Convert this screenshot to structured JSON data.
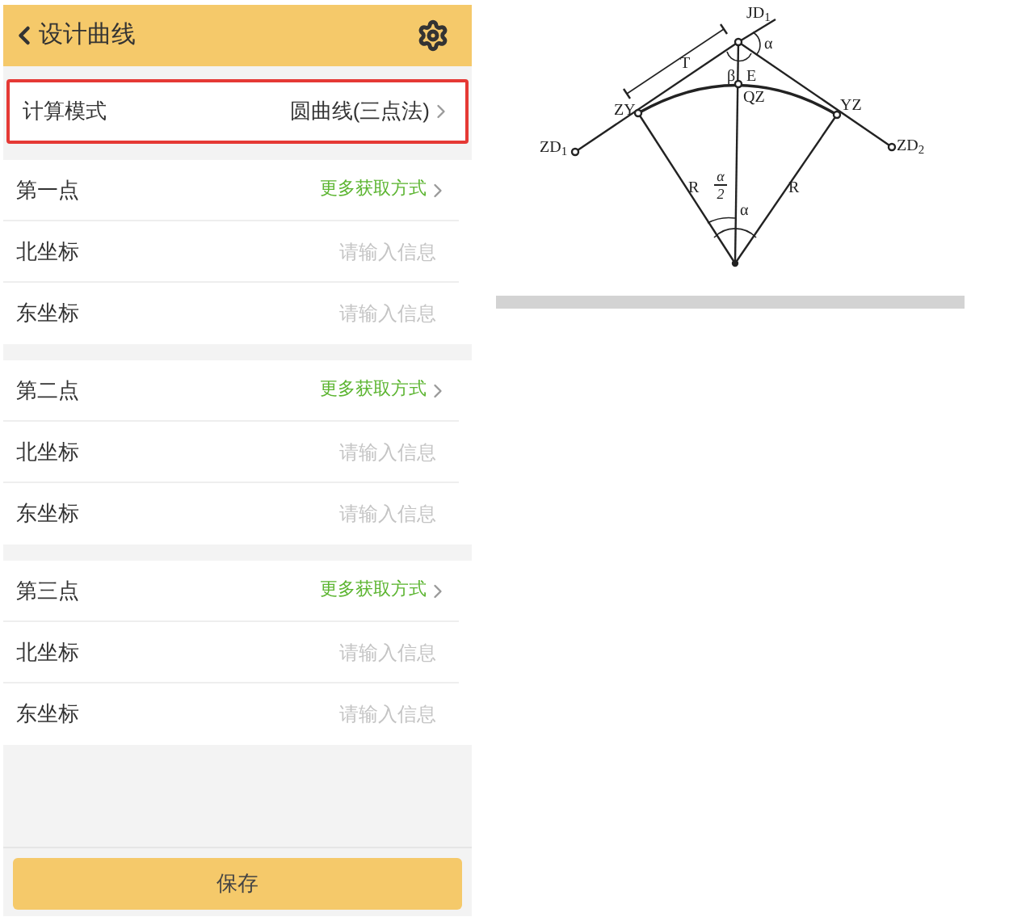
{
  "header": {
    "title": "设计曲线"
  },
  "mode_row": {
    "label": "计算模式",
    "value": "圆曲线(三点法)",
    "highlighted": true
  },
  "sections": [
    {
      "title": "第一点",
      "link": "更多获取方式",
      "fields": [
        {
          "label": "北坐标",
          "placeholder": "请输入信息"
        },
        {
          "label": "东坐标",
          "placeholder": "请输入信息"
        }
      ]
    },
    {
      "title": "第二点",
      "link": "更多获取方式",
      "fields": [
        {
          "label": "北坐标",
          "placeholder": "请输入信息"
        },
        {
          "label": "东坐标",
          "placeholder": "请输入信息"
        }
      ]
    },
    {
      "title": "第三点",
      "link": "更多获取方式",
      "fields": [
        {
          "label": "北坐标",
          "placeholder": "请输入信息"
        },
        {
          "label": "东坐标",
          "placeholder": "请输入信息"
        }
      ]
    }
  ],
  "save_button": "保存",
  "diagram": {
    "labels": [
      {
        "kind": "text",
        "text": "JD$_{1}$"
      },
      {
        "kind": "text",
        "text": "α"
      },
      {
        "kind": "text",
        "text": "T"
      },
      {
        "kind": "text",
        "text": "β"
      },
      {
        "kind": "text",
        "text": "E"
      },
      {
        "kind": "text",
        "text": "QZ"
      },
      {
        "kind": "text",
        "text": "ZY"
      },
      {
        "kind": "text",
        "text": "YZ"
      },
      {
        "kind": "text",
        "text": "ZD$_{1}$"
      },
      {
        "kind": "text",
        "text": "ZD$_{2}$"
      },
      {
        "kind": "text",
        "text": "R"
      },
      {
        "kind": "fraction",
        "numerator": "α",
        "denominator": "2"
      },
      {
        "kind": "text",
        "text": "R"
      },
      {
        "kind": "text",
        "text": "α"
      }
    ]
  }
}
